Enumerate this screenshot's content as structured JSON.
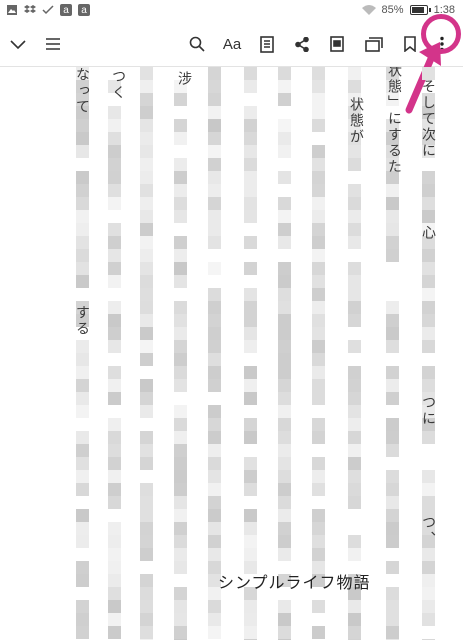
{
  "status_bar": {
    "battery_percent": "85%",
    "time": "1:38",
    "icons": [
      "image-icon",
      "dropbox-icon",
      "check-icon",
      "amazon-icon",
      "amazon-icon",
      "wifi-icon",
      "battery-icon"
    ],
    "amazon_glyph": "a"
  },
  "toolbar": {
    "font_button_label": "Aa",
    "icons": [
      "chevron-down-icon",
      "menu-icon",
      "search-icon",
      "font-icon",
      "notes-icon",
      "share-icon",
      "xray-icon",
      "page-flip-icon",
      "bookmark-icon",
      "more-vertical-icon"
    ]
  },
  "annotation": {
    "highlight_color": "#d3348a",
    "target": "more-vertical-icon"
  },
  "reader": {
    "columns": [
      {
        "text": "そして次に"
      },
      {
        "text": "状態」にするた"
      },
      {
        "text": "状態が"
      },
      {
        "text": "涉"
      },
      {
        "text": "つく"
      },
      {
        "text": "なって"
      },
      {
        "text": "心"
      },
      {
        "text": "つに"
      },
      {
        "text": "つ、"
      },
      {
        "text": "する"
      }
    ],
    "watermark": "シンプルライフ物語"
  }
}
